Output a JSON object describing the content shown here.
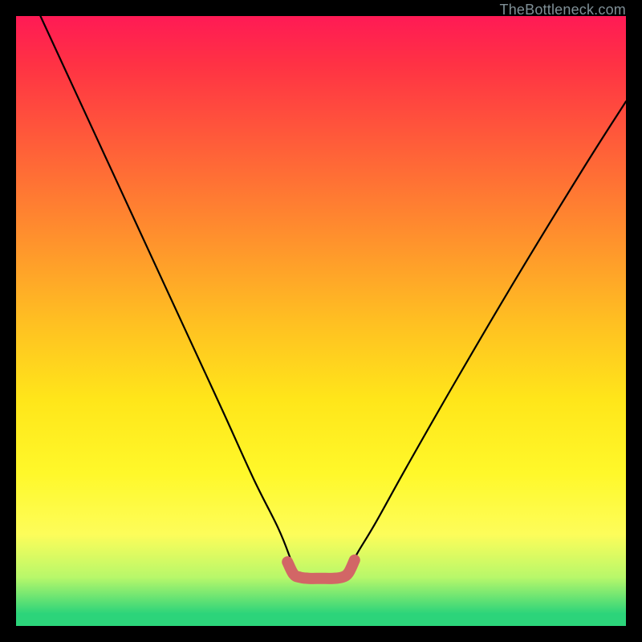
{
  "watermark": "TheBottleneck.com",
  "chart_data": {
    "type": "line",
    "title": "",
    "xlabel": "",
    "ylabel": "",
    "xlim": [
      0,
      100
    ],
    "ylim": [
      0,
      100
    ],
    "series": [
      {
        "name": "black-curve",
        "x": [
          4,
          10,
          16,
          22,
          28,
          34,
          39,
          43,
          45,
          46,
          50,
          54,
          55,
          56,
          59,
          64,
          72,
          82,
          93,
          100
        ],
        "values": [
          100,
          87,
          74,
          61,
          48,
          35,
          24,
          16,
          11,
          8,
          8,
          8,
          10,
          12,
          17,
          26,
          40,
          57,
          75,
          86
        ]
      },
      {
        "name": "red-highlight",
        "x": [
          44.5,
          45.5,
          46.5,
          48,
          50,
          52,
          53.5,
          54.5,
          55.5
        ],
        "values": [
          10.5,
          8.5,
          8.0,
          7.8,
          7.8,
          7.8,
          8.0,
          8.7,
          10.8
        ]
      }
    ],
    "colors": {
      "curve": "#000000",
      "highlight": "#d26666"
    }
  }
}
